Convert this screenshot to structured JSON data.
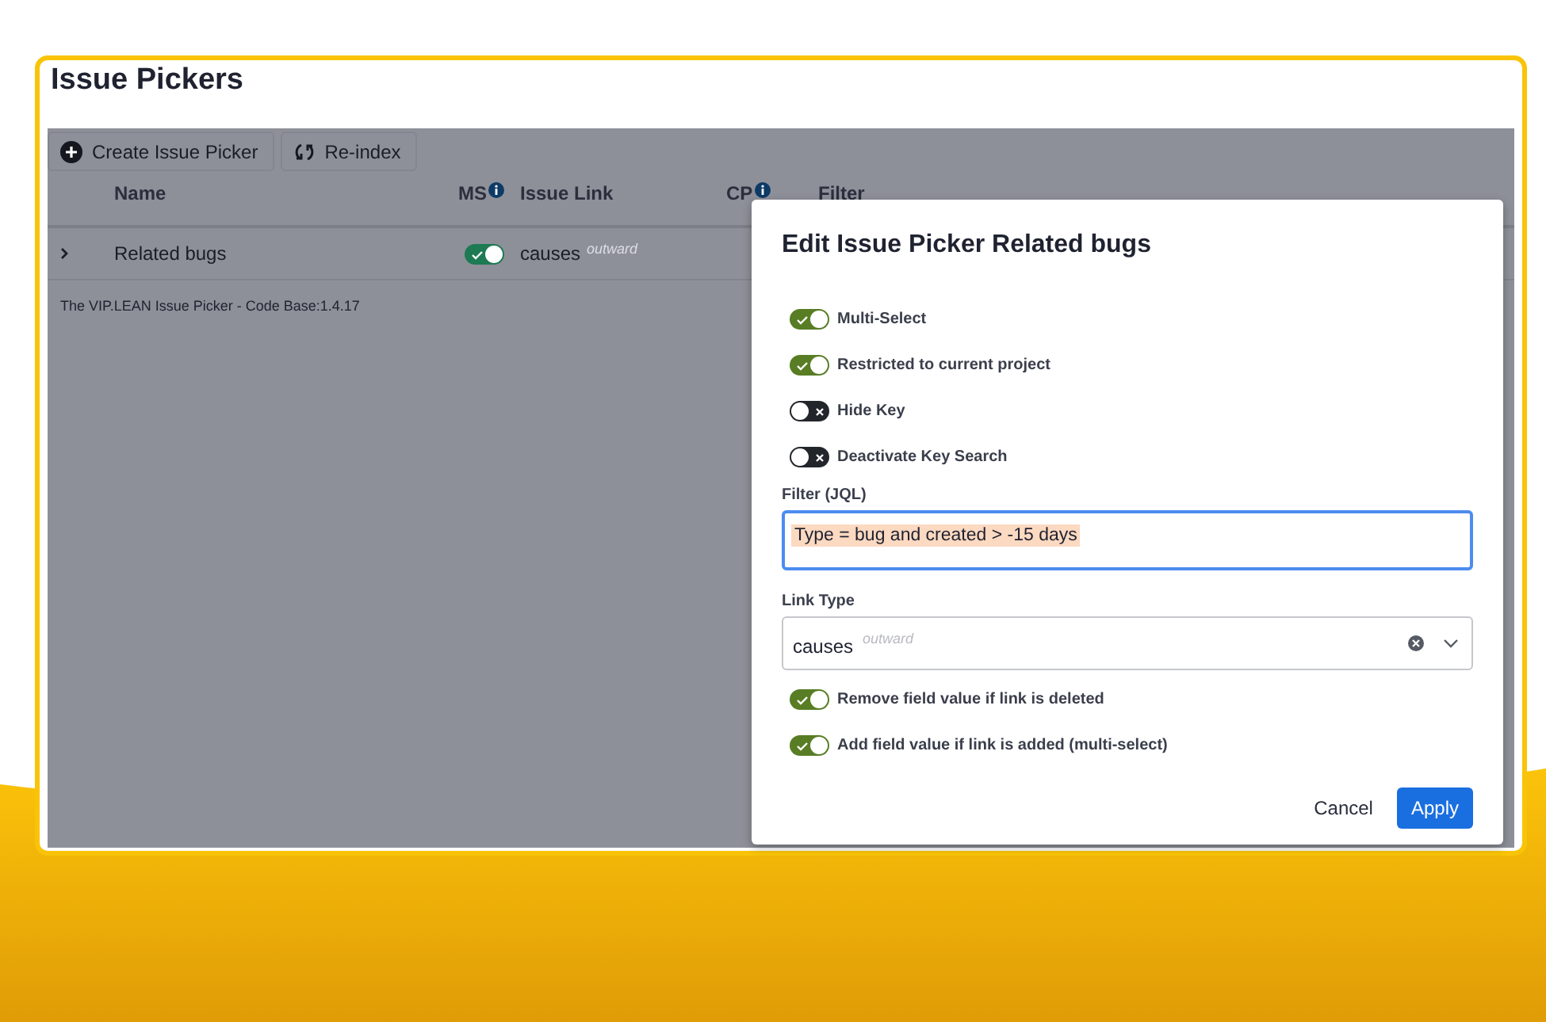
{
  "page": {
    "title": "Issue Pickers"
  },
  "toolbar": [
    {
      "label": "Create Issue Picker",
      "kind": "create"
    },
    {
      "label": "Re-index",
      "kind": "reindex"
    }
  ],
  "table": {
    "columns": [
      {
        "label": "Name",
        "info": false
      },
      {
        "label": "MS",
        "info": true
      },
      {
        "label": "Issue Link",
        "info": false
      },
      {
        "label": "CP",
        "info": true
      },
      {
        "label": "Filter",
        "info": false
      }
    ],
    "rows": [
      {
        "name": "Related bugs",
        "expanded": false,
        "ms": true,
        "link": "causes",
        "direction": "outward"
      }
    ]
  },
  "footer": "The VIP.LEAN Issue Picker - Code Base:1.4.17",
  "dialog": {
    "title": "Edit Issue Picker Related bugs",
    "toggles": [
      {
        "label": "Multi-Select",
        "on": true
      },
      {
        "label": "Restricted to current project",
        "on": true
      },
      {
        "label": "Hide Key",
        "on": false
      },
      {
        "label": "Deactivate Key Search",
        "on": false
      }
    ],
    "filter": {
      "label": "Filter (JQL)",
      "value": "Type = bug and created > -15 days"
    },
    "link_type": {
      "label": "Link Type",
      "value": "causes",
      "direction": "outward"
    },
    "toggles_after": [
      {
        "label": "Remove field value if link is deleted",
        "on": true
      },
      {
        "label": "Add field value if link is added (multi-select)",
        "on": true
      }
    ],
    "buttons": [
      {
        "label": "Cancel",
        "kind": "subtle"
      },
      {
        "label": "Apply",
        "kind": "primary"
      }
    ]
  }
}
